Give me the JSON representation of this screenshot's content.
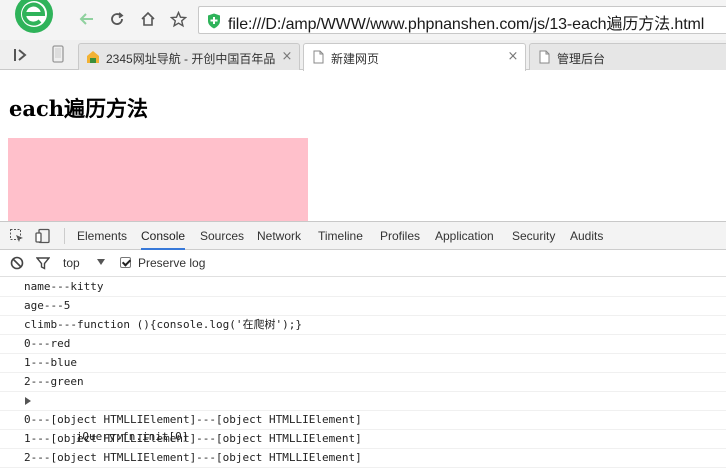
{
  "browser": {
    "url": "file:///D:/amp/WWW/www.phpnanshen.com/js/13-each遍历方法.html",
    "tabs": [
      {
        "title": "2345网址导航 - 开创中国百年品",
        "close": "×"
      },
      {
        "title": "新建网页",
        "close": "×"
      },
      {
        "title": "管理后台"
      }
    ]
  },
  "page": {
    "heading": "each遍历方法",
    "box_color": "#ffc0cb"
  },
  "devtools": {
    "tabs": [
      "Elements",
      "Console",
      "Sources",
      "Network",
      "Timeline",
      "Profiles",
      "Application",
      "Security",
      "Audits"
    ],
    "active_tab": "Console",
    "context": "top",
    "preserve_log_label": "Preserve log",
    "preserve_log_checked": true,
    "logs": [
      "name---kitty",
      "age---5",
      "climb---function (){console.log('在爬树');}",
      "0---red",
      "1---blue",
      "2---green",
      "jQuery.fn.init[0]",
      "0---[object HTMLLIElement]---[object HTMLLIElement]",
      "1---[object HTMLLIElement]---[object HTMLLIElement]",
      "2---[object HTMLLIElement]---[object HTMLLIElement]"
    ]
  },
  "colors": {
    "accent_green": "#2fb35a",
    "devtools_tab_active": "#3879d9"
  }
}
